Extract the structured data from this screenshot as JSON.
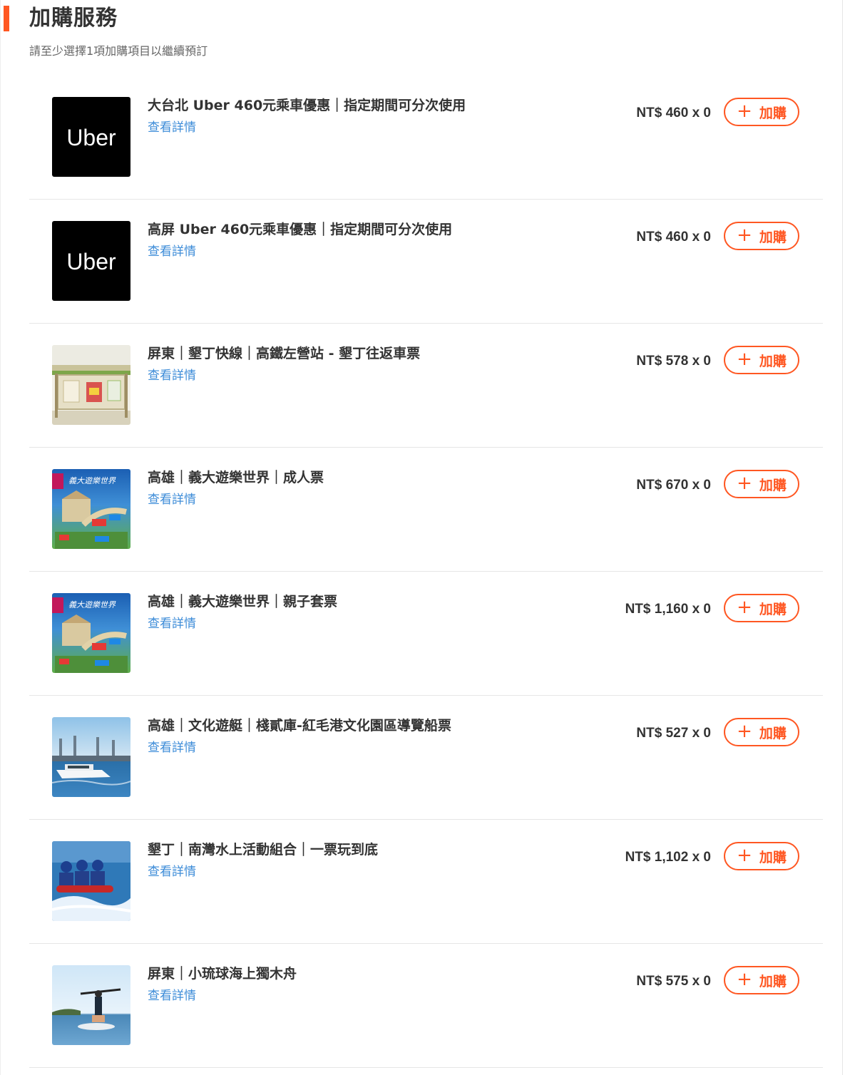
{
  "section": {
    "title": "加購服務",
    "subtitle": "請至少選擇1項加購項目以繼續預訂",
    "accent_color": "#ff5722",
    "link_color": "#3d8cd8"
  },
  "items": [
    {
      "name": "大台北 Uber 460元乘車優惠｜指定期間可分次使用",
      "detail": "查看詳情",
      "price": "NT$ 460 x 0",
      "add": "加購",
      "image": "uber-logo",
      "logo_text": "Uber"
    },
    {
      "name": "高屏 Uber 460元乘車優惠｜指定期間可分次使用",
      "detail": "查看詳情",
      "price": "NT$ 460 x 0",
      "add": "加購",
      "image": "uber-logo",
      "logo_text": "Uber"
    },
    {
      "name": "屏東｜墾丁快線｜高鐵左營站 - 墾丁往返車票",
      "detail": "查看詳情",
      "price": "NT$ 578 x 0",
      "add": "加購",
      "image": "bus-stop-photo"
    },
    {
      "name": "高雄｜義大遊樂世界｜成人票",
      "detail": "查看詳情",
      "price": "NT$ 670 x 0",
      "add": "加購",
      "image": "theme-park-photo"
    },
    {
      "name": "高雄｜義大遊樂世界｜親子套票",
      "detail": "查看詳情",
      "price": "NT$ 1,160 x 0",
      "add": "加購",
      "image": "theme-park-photo"
    },
    {
      "name": "高雄｜文化遊艇｜棧貳庫-紅毛港文化園區導覽船票",
      "detail": "查看詳情",
      "price": "NT$ 527 x 0",
      "add": "加購",
      "image": "harbor-boat-photo"
    },
    {
      "name": "墾丁｜南灣水上活動組合｜一票玩到底",
      "detail": "查看詳情",
      "price": "NT$ 1,102 x 0",
      "add": "加購",
      "image": "banana-boat-photo"
    },
    {
      "name": "屏東｜小琉球海上獨木舟",
      "detail": "查看詳情",
      "price": "NT$ 575 x 0",
      "add": "加購",
      "image": "kayak-photo"
    }
  ]
}
